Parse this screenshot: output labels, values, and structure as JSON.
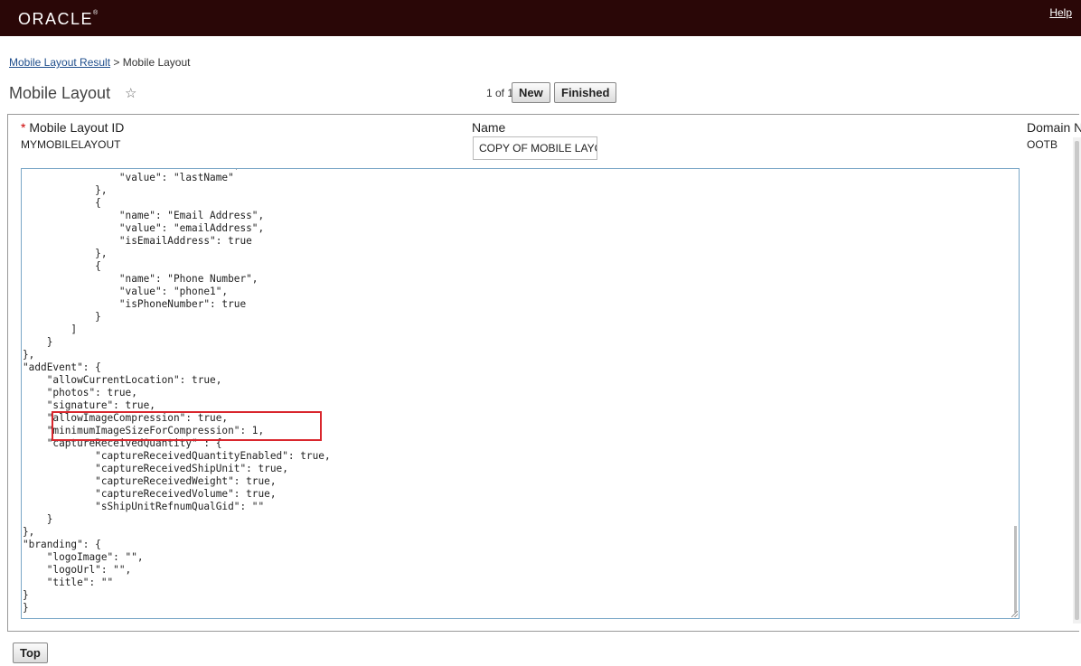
{
  "header": {
    "logo": "ORACLE",
    "help_label": "Help"
  },
  "breadcrumb": {
    "parent": "Mobile Layout Result",
    "separator": ">",
    "current": "Mobile Layout"
  },
  "page": {
    "title": "Mobile Layout",
    "star_icon": "star-icon"
  },
  "pager": {
    "text": "1 of 1",
    "new_label": "New",
    "finished_label": "Finished"
  },
  "fields": {
    "layout_id_label": "Mobile Layout ID",
    "layout_id_required": "*",
    "layout_id_value": "MYMOBILELAYOUT",
    "name_label": "Name",
    "name_value": "COPY OF MOBILE LAYOUT",
    "domain_label": "Domain N",
    "domain_value": "OOTB"
  },
  "editor": {
    "content": "                \"name\": \"Last Name\",\n                \"value\": \"lastName\"\n            },\n            {\n                \"name\": \"Email Address\",\n                \"value\": \"emailAddress\",\n                \"isEmailAddress\": true\n            },\n            {\n                \"name\": \"Phone Number\",\n                \"value\": \"phone1\",\n                \"isPhoneNumber\": true\n            }\n        ]\n    }\n},\n\"addEvent\": {\n    \"allowCurrentLocation\": true,\n    \"photos\": true,\n    \"signature\": true,\n    \"allowImageCompression\": true,\n    \"minimumImageSizeForCompression\": 1,\n    \"captureReceivedQuantity\" : {\n            \"captureReceivedQuantityEnabled\": true,\n            \"captureReceivedShipUnit\": true,\n            \"captureReceivedWeight\": true,\n            \"captureReceivedVolume\": true,\n            \"sShipUnitRefnumQualGid\": \"\"\n    }\n},\n\"branding\": {\n    \"logoImage\": \"\",\n    \"logoUrl\": \"\",\n    \"title\": \"\"\n}\n}"
  },
  "footer": {
    "top_label": "Top"
  },
  "colors": {
    "header_bg": "#2a0707",
    "link": "#1f4e8c",
    "highlight": "#d9262d",
    "required": "#cc0000"
  }
}
